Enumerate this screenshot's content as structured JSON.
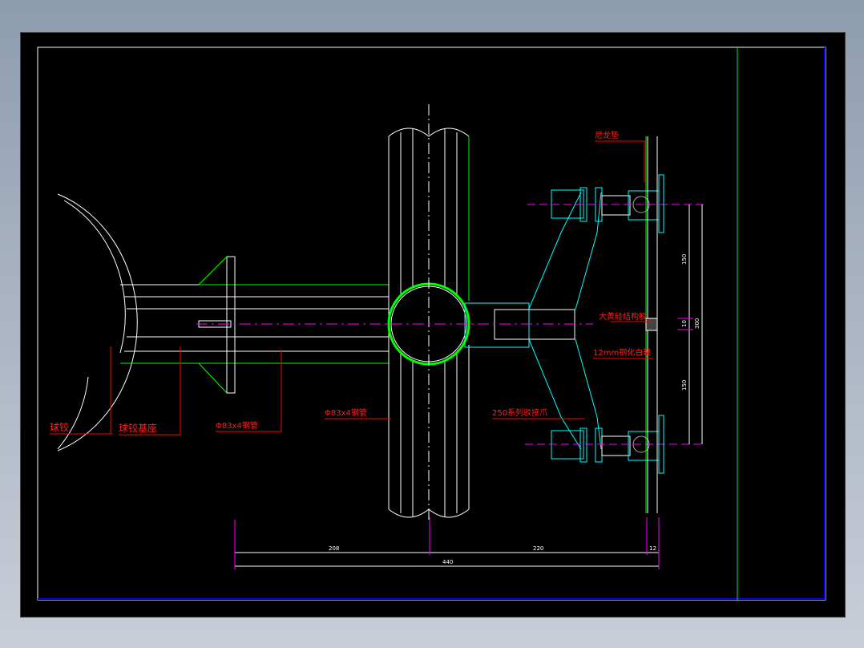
{
  "drawing": {
    "labels": {
      "ball_joint": "球铰",
      "ball_joint_base": "球铰基座",
      "steel_pipe_left": "Φ83x4钢管",
      "steel_pipe_center": "Φ83x4钢管",
      "nylon_pad": "尼龙垫",
      "sealant": "大黄硅结构胶",
      "glass": "12mm钢化白玻",
      "spider_claw": "250系列驳接爪"
    },
    "dimensions": {
      "left_span": "208",
      "right_span": "220",
      "glass_offset": "12",
      "total": "440",
      "upper": "150",
      "joint_gap": "10",
      "overall_height": "300",
      "lower": "150"
    },
    "colors": {
      "frame": "#0000ff",
      "green": "#00ff00",
      "cyan": "#00ffff",
      "magenta": "#ff00ff",
      "red": "#ff0000",
      "white": "#ffffff"
    }
  }
}
